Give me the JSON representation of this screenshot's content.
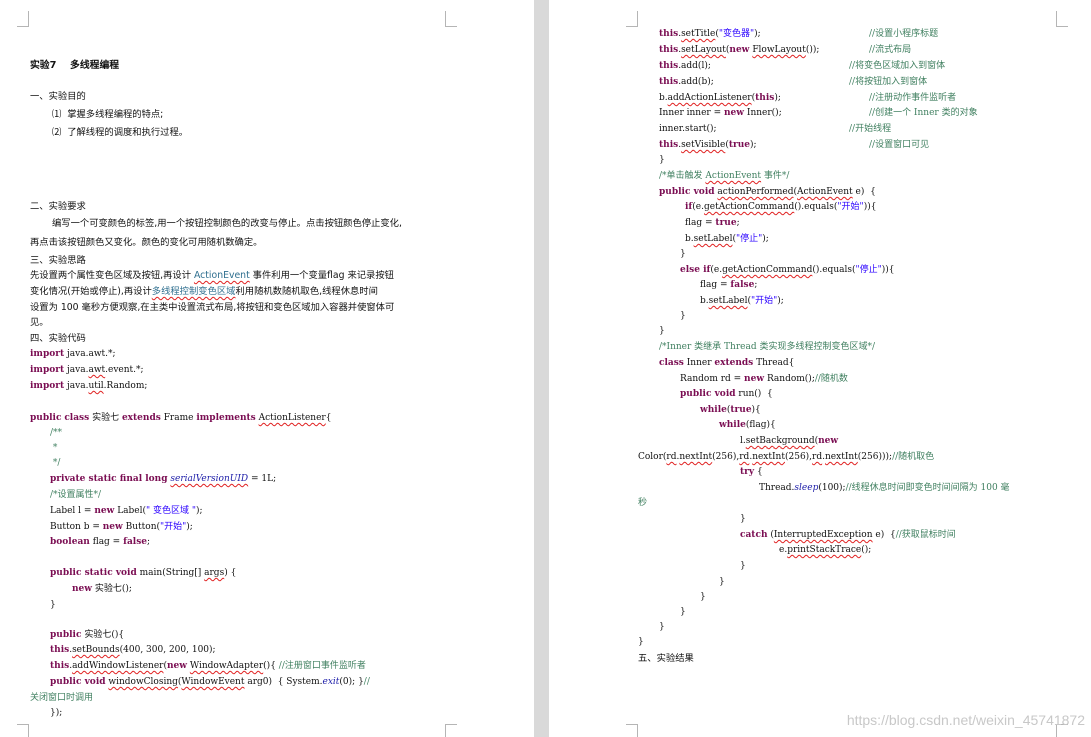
{
  "left_page": {
    "title": "实验7    多线程编程",
    "s1_heading": "一、实验目的",
    "s1_items": [
      "⑴  掌握多线程编程的特点;",
      "⑵  了解线程的调度和执行过程。"
    ],
    "s2_heading": "二、实验要求",
    "s2_line1": "编写一个可变颜色的标签,用一个按钮控制颜色的改变与停止。点击按钮颜色停止变化,",
    "s2_line2": "再点击该按钮颜色又变化。颜色的变化可用随机数确定。",
    "s3_heading": "三、实验思路",
    "s3_line1_a": "先设置两个属性变色区域及按钮,再设计 ",
    "s3_line1_link": "ActionEvent",
    "s3_line1_b": " 事件利用一个变量flag 来记录按钮",
    "s3_line2_a": "变化情况(开始或停止),再设计",
    "s3_line2_link": "多线程控制变色区域",
    "s3_line2_b": "利用随机数随机取色,线程休息时间",
    "s3_line3": "设置为 100 毫秒方便观察,在主类中设置流式布局,将按钮和变色区域加入容器并使窗体可",
    "s3_line4": "见。",
    "s4_heading": "四、实验代码",
    "code": {
      "imp_kw": "import",
      "imp1": " java.awt.*;",
      "imp2a": " java.",
      "imp2b": "awt",
      "imp2c": ".event.*;",
      "imp3a": " java.",
      "imp3b": "util",
      "imp3c": ".Random;",
      "cls_public": "public",
      "cls_class": "class",
      "cls_name": " 实验七 ",
      "cls_extends": "extends",
      "cls_frame": " Frame ",
      "cls_impl": "implements",
      "cls_al": "ActionListener",
      "cls_brace": "{",
      "jd1": "/**",
      "jd2": " *",
      "jd3": " */",
      "suid_kw": "private static final long",
      "suid_name": "serialVersionUID",
      "suid_val": " = 1L;",
      "attr_comment": "/*设置属性*/",
      "lbl_a": "Label l = ",
      "lbl_new": "new",
      "lbl_b": " Label(",
      "lbl_str": "\" 变色区域 \"",
      "lbl_c": ");",
      "btn_a": "Button b = ",
      "btn_new": "new",
      "btn_b": " Button(",
      "btn_str": "\"开始\"",
      "btn_c": ");",
      "flag_kw": "boolean",
      "flag_a": " flag = ",
      "flag_false": "false",
      "flag_b": ";",
      "main_kw": "public static void",
      "main_a": " main(String[] ",
      "main_args": "args",
      "main_b": ") {",
      "main_new": "new",
      "main_call": " 实验七();",
      "close1": "}",
      "ctor_kw": "public",
      "ctor_name": " 实验七(){",
      "bounds_this": "this",
      "bounds_a": ".",
      "bounds_m": "setBounds",
      "bounds_b": "(400, 300, 200, 100);",
      "awl_this": "this",
      "awl_a": ".",
      "awl_m": "addWindowListener",
      "awl_b": "(",
      "awl_new": "new",
      "awl_c": " ",
      "awl_wa": "WindowAdapter",
      "awl_d": "(){ ",
      "awl_cm": "//注册窗口事件监听者",
      "wc_kw": "public void",
      "wc_sp": " ",
      "wc_m": "windowClosing",
      "wc_a": "(",
      "wc_we": "WindowEvent",
      "wc_b": " arg0)  { System.",
      "wc_exit": "exit",
      "wc_c": "(0); }",
      "wc_cm": "//",
      "wc_cm2": "关闭窗口时调用",
      "close_anon": "});"
    }
  },
  "right_page": {
    "code": {
      "st_this": "this",
      "st_a": ".",
      "st_m": "setTitle",
      "st_b": "(",
      "st_str": "\"变色器\"",
      "st_c": ");",
      "st_cm": "//设置小程序标题",
      "sl_this": "this",
      "sl_a": ".",
      "sl_m": "setLayout",
      "sl_b": "(",
      "sl_new": "new",
      "sl_c": " ",
      "sl_fl": "FlowLayout",
      "sl_d": "());",
      "sl_cm": "//流式布局",
      "al_this": "this",
      "al_a": ".add(l);",
      "al_cm": "//将变色区域加入到窗体",
      "ab_this": "this",
      "ab_a": ".add(b);",
      "ab_cm": "//将按钮加入到窗体",
      "bal_a": "b.",
      "bal_m": "addActionListener",
      "bal_b": "(",
      "bal_this": "this",
      "bal_c": ");",
      "bal_cm": "//注册动作事件监听者",
      "inn_a": "Inner inner = ",
      "inn_new": "new",
      "inn_b": " Inner();",
      "inn_cm": "//创建一个 Inner 类的对象",
      "is_a": "inner.start();",
      "is_cm": "//开始线程",
      "sv_this": "this",
      "sv_a": ".",
      "sv_m": "setVisible",
      "sv_b": "(",
      "sv_true": "true",
      "sv_c": ");",
      "sv_cm": "//设置窗口可见",
      "close1": "}",
      "ev_cm_a": "/*单击触发 ",
      "ev_cm_link": "ActionEvent",
      "ev_cm_b": " 事件*/",
      "ap_kw": "public void",
      "ap_sp": " ",
      "ap_m": "actionPerformed",
      "ap_a": "(",
      "ap_ae": "ActionEvent",
      "ap_b": " e)  {",
      "if_kw": "if",
      "if_a": "(e.",
      "if_m": "getActionCommand",
      "if_b": "().equals(",
      "if_str": "\"开始\"",
      "if_c": ")){",
      "f1_a": "flag = ",
      "f1_true": "true",
      "f1_b": ";",
      "s1_a": "b.",
      "s1_m": "setLabel",
      "s1_b": "(",
      "s1_str": "\"停止\"",
      "s1_c": ");",
      "close_if": "}",
      "else_kw": "else if",
      "el_a": "(e.",
      "el_m": "getActionCommand",
      "el_b": "().equals(",
      "el_str": "\"停止\"",
      "el_c": ")){",
      "f2_a": "flag = ",
      "f2_false": "false",
      "f2_b": ";",
      "s2_a": "b.",
      "s2_m": "setLabel",
      "s2_b": "(",
      "s2_str": "\"开始\"",
      "s2_c": ");",
      "close_el": "}",
      "close_ap": "}",
      "inner_cm": "/*Inner 类继承 Thread 类实现多线程控制变色区域*/",
      "ic_kw": "class",
      "ic_a": " Inner ",
      "ic_ext": "extends",
      "ic_b": " Thread{",
      "rd_a": "Random rd = ",
      "rd_new": "new",
      "rd_b": " Random();",
      "rd_cm": "//随机数",
      "run_kw": "public void",
      "run_a": " run()  {",
      "wt_kw": "while",
      "wt_a": "(",
      "wt_true": "true",
      "wt_b": "){",
      "wf_kw": "while",
      "wf_a": "(flag){",
      "bg_a": "l.",
      "bg_m": "setBackground",
      "bg_b": "(",
      "bg_new": "new",
      "col_a": "Color(",
      "col_rd1": "rd",
      "col_b": ".",
      "col_ni1": "nextInt",
      "col_c": "(256),",
      "col_rd2": "rd",
      "col_d": ".",
      "col_ni2": "nextInt",
      "col_e": "(256),",
      "col_rd3": "rd",
      "col_f": ".",
      "col_ni3": "nextInt",
      "col_g": "(256)));",
      "col_cm": "//随机取色",
      "try_kw": "try",
      "try_a": " {",
      "sl2_a": "Thread.",
      "sl2_m": "sleep",
      "sl2_b": "(100);",
      "sl2_cm": "//线程休息时间即变色时间间隔为 100 毫",
      "sl2_cm2": "秒",
      "close_try": "}",
      "catch_kw": "catch",
      "catch_a": " (",
      "catch_ie": "InterruptedException",
      "catch_b": " e)  {",
      "catch_cm": "//获取鼠标时间",
      "pst_a": "e.",
      "pst_m": "printStackTrace",
      "pst_b": "();",
      "c6": "}",
      "c5": "}",
      "c4": "}",
      "c3": "}",
      "c2": "}",
      "c1": "}"
    },
    "s5_heading": "五、实验结果"
  },
  "watermark": "https://blog.csdn.net/weixin_45741872"
}
